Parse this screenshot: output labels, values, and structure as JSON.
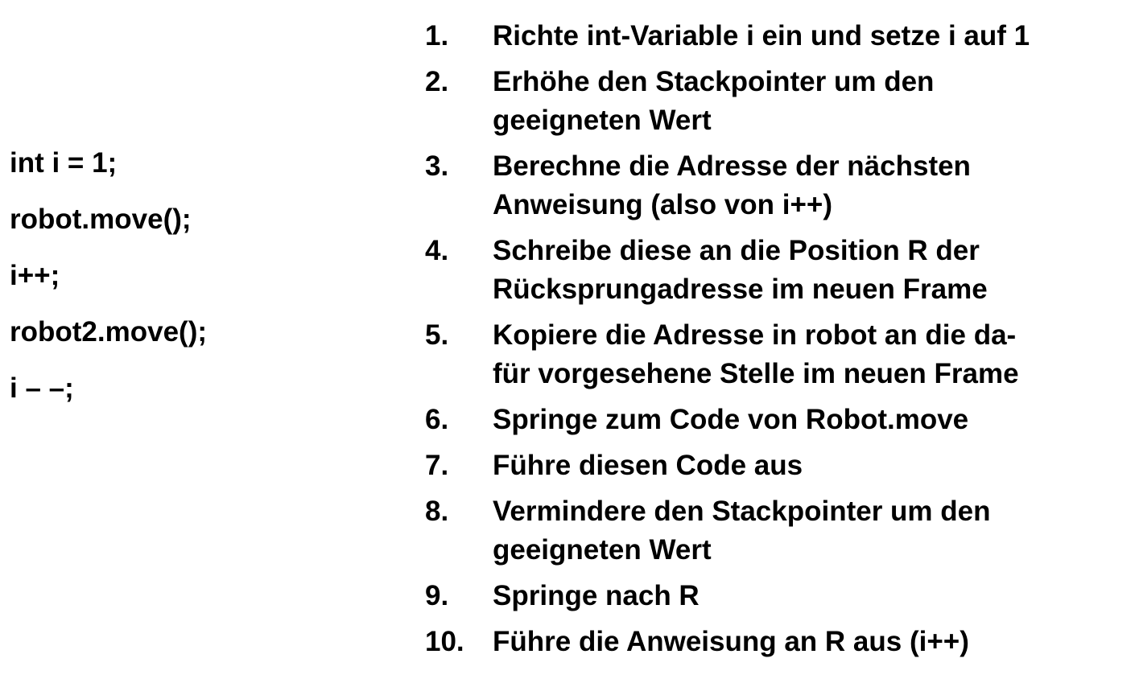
{
  "code": {
    "lines": [
      "int i = 1;",
      "robot.move();",
      "i++;",
      "robot2.move();",
      "i – –;"
    ]
  },
  "steps": [
    {
      "number": "1.",
      "lines": [
        "Richte int-Variable i ein und setze i auf 1"
      ]
    },
    {
      "number": "2.",
      "lines": [
        "Erhöhe den Stackpointer um den",
        "geeigneten Wert"
      ]
    },
    {
      "number": "3.",
      "lines": [
        "Berechne die Adresse der nächsten",
        "Anweisung (also von i++)"
      ]
    },
    {
      "number": "4.",
      "lines": [
        "Schreibe diese an die Position R der",
        "Rücksprungadresse im neuen Frame"
      ]
    },
    {
      "number": "5.",
      "lines": [
        "Kopiere die Adresse in robot an die da-",
        "für vorgesehene Stelle im neuen Frame"
      ]
    },
    {
      "number": "6.",
      "lines": [
        "Springe zum Code von Robot.move"
      ]
    },
    {
      "number": "7.",
      "lines": [
        "Führe diesen Code aus"
      ]
    },
    {
      "number": "8.",
      "lines": [
        "Vermindere den Stackpointer um den",
        "geeigneten Wert"
      ]
    },
    {
      "number": "9.",
      "lines": [
        "Springe nach R"
      ]
    },
    {
      "number": "10.",
      "lines": [
        "Führe die Anweisung an R aus (i++)"
      ]
    }
  ]
}
